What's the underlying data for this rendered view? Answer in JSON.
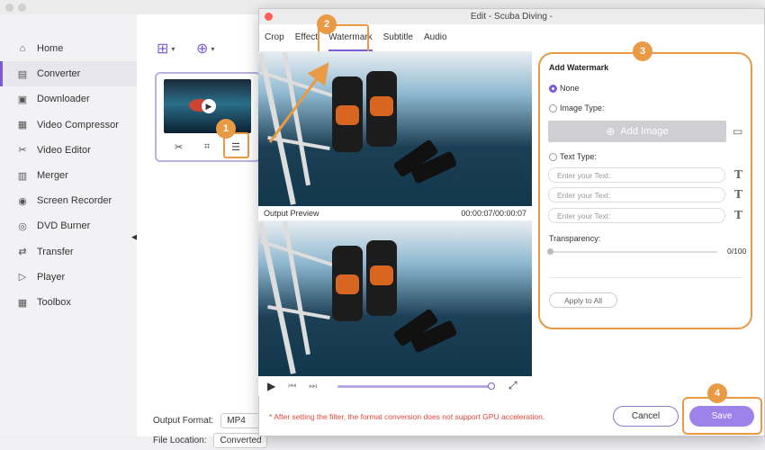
{
  "dialog": {
    "title": "Edit - Scuba Diving -"
  },
  "sidebar": {
    "items": [
      {
        "label": "Home",
        "icon": "home-icon",
        "glyph": "⌂"
      },
      {
        "label": "Converter",
        "icon": "converter-icon",
        "glyph": "▤"
      },
      {
        "label": "Downloader",
        "icon": "downloader-icon",
        "glyph": "▣"
      },
      {
        "label": "Video Compressor",
        "icon": "compressor-icon",
        "glyph": "▦"
      },
      {
        "label": "Video Editor",
        "icon": "video-editor-icon",
        "glyph": "✂"
      },
      {
        "label": "Merger",
        "icon": "merger-icon",
        "glyph": "▥"
      },
      {
        "label": "Screen Recorder",
        "icon": "screen-recorder-icon",
        "glyph": "◉"
      },
      {
        "label": "DVD Burner",
        "icon": "dvd-icon",
        "glyph": "◎"
      },
      {
        "label": "Transfer",
        "icon": "transfer-icon",
        "glyph": "⇄"
      },
      {
        "label": "Player",
        "icon": "player-icon",
        "glyph": "▷"
      },
      {
        "label": "Toolbox",
        "icon": "toolbox-icon",
        "glyph": "▦"
      }
    ],
    "active_index": 1
  },
  "tabs": [
    "Crop",
    "Effect",
    "Watermark",
    "Subtitle",
    "Audio"
  ],
  "active_tab": "Watermark",
  "preview": {
    "output_label": "Output Preview",
    "timecode": "00:00:07/00:00:07",
    "progress": 1.0
  },
  "watermark": {
    "title": "Add Watermark",
    "none_label": "None",
    "image_type_label": "Image Type:",
    "add_image_label": "Add Image",
    "text_type_label": "Text Type:",
    "text_placeholder": "Enter your Text:",
    "transparency_label": "Transparency:",
    "transparency_value": "0/100",
    "transparency_fraction": 0.0,
    "apply_label": "Apply to All",
    "selected": "None"
  },
  "footer": {
    "note": "* After setting the filter, the format conversion does not support GPU acceleration.",
    "cancel": "Cancel",
    "save": "Save"
  },
  "bottom": {
    "output_format_label": "Output Format:",
    "output_format_value": "MP4",
    "file_location_label": "File Location:",
    "file_location_value": "Converted"
  },
  "callouts": [
    "1",
    "2",
    "3",
    "4"
  ],
  "colors": {
    "accent": "#7b5cd6",
    "callout": "#e99a45",
    "warning": "#e0463a"
  }
}
